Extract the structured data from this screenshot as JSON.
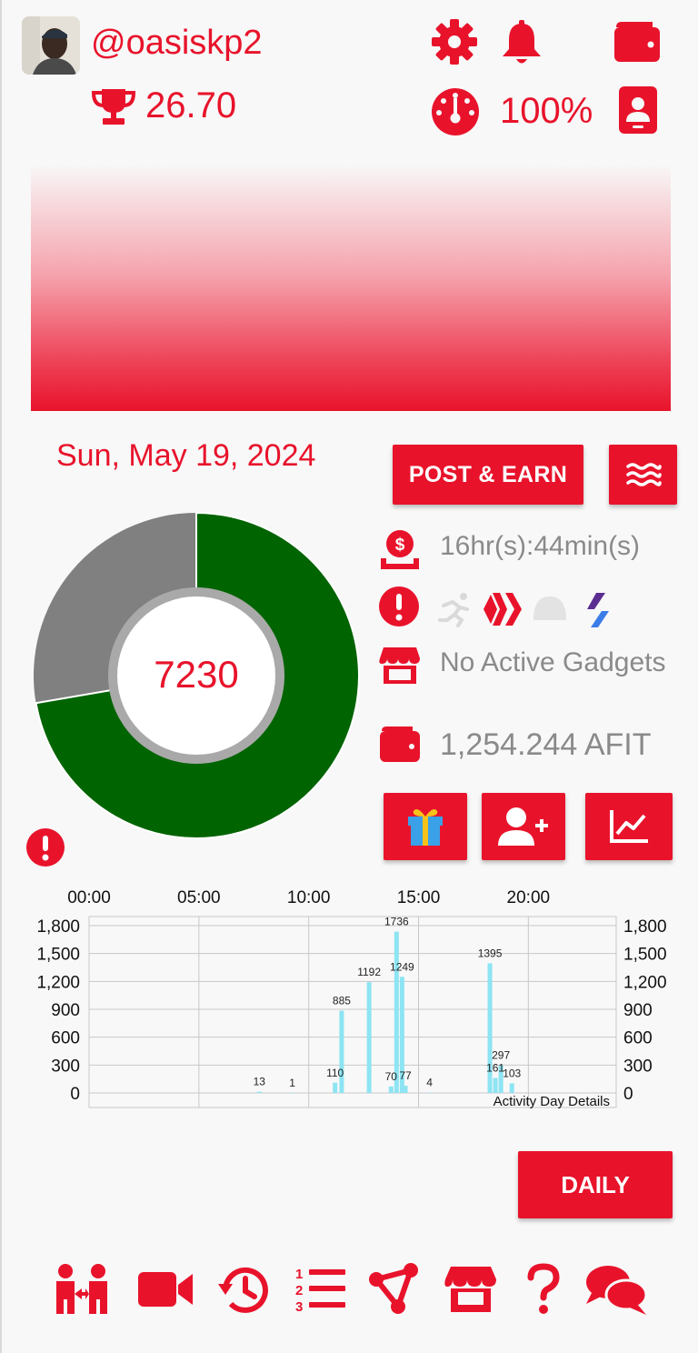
{
  "header": {
    "username": "@oasiskp2",
    "score": "26.70",
    "battery": "100%",
    "icons": [
      "gear-icon",
      "bell-icon",
      "wallet-icon",
      "gauge-icon",
      "id-card-icon",
      "trophy-icon"
    ]
  },
  "date": "Sun, May 19, 2024",
  "actions": {
    "post_earn_label": "POST & EARN",
    "daily_label": "DAILY"
  },
  "summary": {
    "steps": "7230",
    "countdown": "16hr(s):44min(s)",
    "gadgets": "No Active Gadgets",
    "balance": "1,254.244 AFIT"
  },
  "colors": {
    "accent": "#e8132b",
    "progress": "#006400",
    "remaining": "#808080",
    "bars": "#8de4f2"
  },
  "chart_data": {
    "type": "bar",
    "title": "",
    "xlabel": "",
    "ylabel": "",
    "x_ticks": [
      "00:00",
      "05:00",
      "10:00",
      "15:00",
      "20:00"
    ],
    "y_ticks": [
      "1,800",
      "1,500",
      "1,200",
      "900",
      "600",
      "300",
      "0"
    ],
    "ylim": [
      0,
      1800
    ],
    "xlim_hours": [
      0,
      24
    ],
    "legend": "Activity Day Details",
    "bars": [
      {
        "hour": 7.75,
        "value": 13
      },
      {
        "hour": 9.25,
        "value": 1
      },
      {
        "hour": 11.2,
        "value": 110
      },
      {
        "hour": 11.5,
        "value": 885
      },
      {
        "hour": 12.75,
        "value": 1192
      },
      {
        "hour": 13.75,
        "value": 70
      },
      {
        "hour": 14.0,
        "value": 1736
      },
      {
        "hour": 14.25,
        "value": 1249
      },
      {
        "hour": 14.4,
        "value": 77
      },
      {
        "hour": 15.5,
        "value": 4
      },
      {
        "hour": 18.25,
        "value": 1395
      },
      {
        "hour": 18.5,
        "value": 161
      },
      {
        "hour": 18.75,
        "value": 297
      },
      {
        "hour": 19.25,
        "value": 103
      }
    ],
    "labels": [
      "13",
      "1",
      "110",
      "885",
      "1192",
      "70",
      "1736",
      "1249",
      "77",
      "4",
      "1395",
      "161",
      "297",
      "103"
    ]
  },
  "donut": {
    "completed": 7230,
    "goal": 10000
  }
}
